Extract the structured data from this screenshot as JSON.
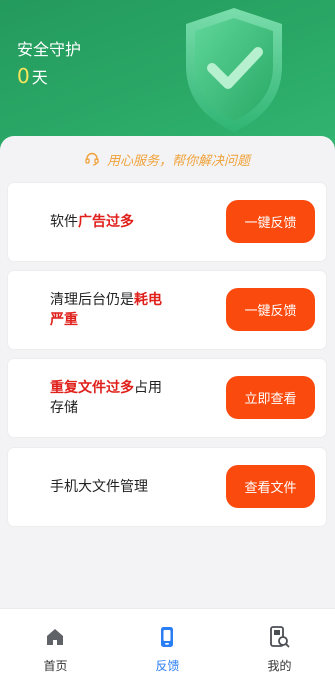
{
  "header": {
    "title": "安全守护",
    "days_count": "0",
    "days_unit": "天"
  },
  "slogan": {
    "icon": "headset-icon",
    "text": "用心服务，帮你解决问题",
    "color": "#f0a23a"
  },
  "cards": [
    {
      "text_parts": [
        "软件",
        "广告过多",
        ""
      ],
      "button": "一键反馈"
    },
    {
      "text_parts": [
        "清理后台仍是",
        "耗电严重",
        ""
      ],
      "button": "一键反馈"
    },
    {
      "text_parts": [
        "",
        "重复文件过多",
        "占用存储"
      ],
      "button": "立即查看"
    },
    {
      "text_parts": [
        "手机大文件管理",
        "",
        ""
      ],
      "button": "查看文件"
    }
  ],
  "tabs": [
    {
      "label": "首页",
      "icon": "home-icon",
      "active": false
    },
    {
      "label": "反馈",
      "icon": "phone-icon",
      "active": true
    },
    {
      "label": "我的",
      "icon": "profile-phone-icon",
      "active": false
    }
  ],
  "colors": {
    "header_green": "#2aa866",
    "accent_orange": "#fb4a0e",
    "highlight_red": "#e0201b",
    "active_tab_blue": "#2a7ef5"
  }
}
